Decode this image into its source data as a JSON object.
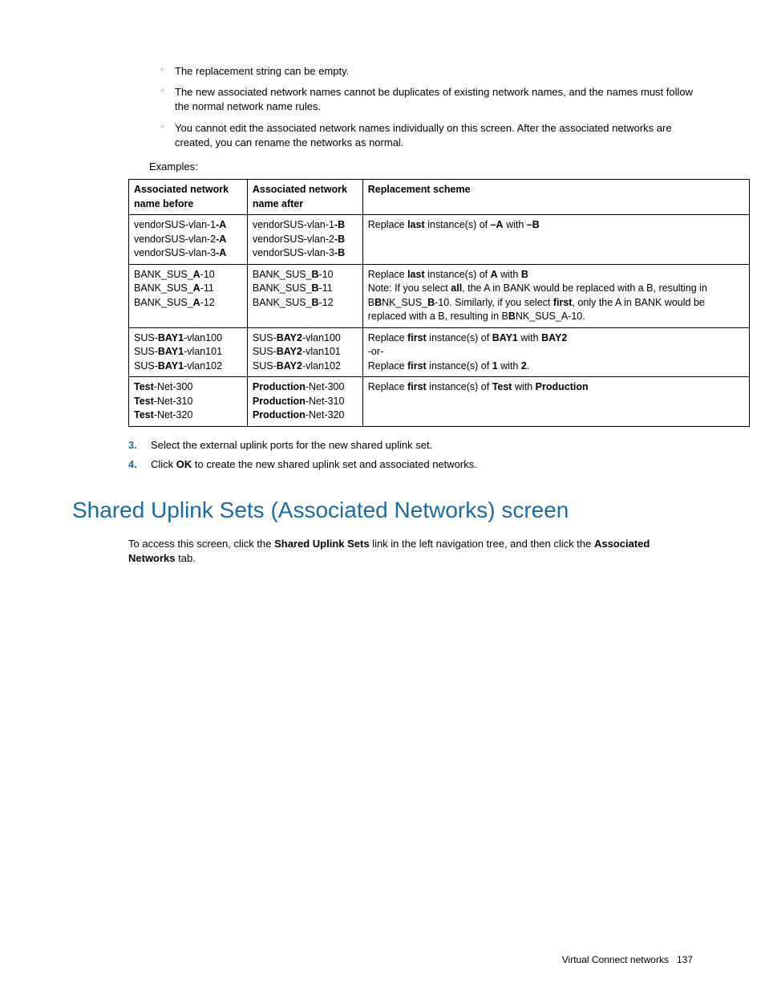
{
  "bullets": [
    "The replacement string can be empty.",
    "The new associated network names cannot be duplicates of existing network names, and the names must follow the normal network name rules.",
    "You cannot edit the associated network names individually on this screen. After the associated networks are created, you can rename the networks as normal."
  ],
  "examples_label": "Examples:",
  "table": {
    "headers": [
      "Associated network name before",
      "Associated network name after",
      "Replacement scheme"
    ],
    "rows_html": [
      {
        "before": "vendorSUS-vlan-1<b>-A</b><br>vendorSUS-vlan-2<b>-A</b><br>vendorSUS-vlan-3<b>-A</b>",
        "after": "vendorSUS-vlan-1<b>-B</b><br>vendorSUS-vlan-2<b>-B</b><br>vendorSUS-vlan-3<b>-B</b>",
        "scheme": "Replace <b>last</b> instance(s) of <b>–A</b> with <b>–B</b>"
      },
      {
        "before": "BANK_SUS_<b>A</b>-10<br>BANK_SUS_<b>A</b>-11<br>BANK_SUS_<b>A</b>-12",
        "after": "BANK_SUS_<b>B</b>-10<br>BANK_SUS_<b>B</b>-11<br>BANK_SUS_<b>B</b>-12",
        "scheme": "Replace <b>last</b> instance(s) of <b>A</b> with <b>B</b><br>Note: If you select <b>all</b>, the A in BANK would be replaced with a B, resulting in B<b>B</b>NK_SUS_<b>B</b>-10. Similarly, if you select <b>first</b>, only the A in BANK would be replaced with a B, resulting in B<b>B</b>NK_SUS_A-10."
      },
      {
        "before": "SUS-<b>BAY1</b>-vlan100<br>SUS-<b>BAY1</b>-vlan101<br>SUS-<b>BAY1</b>-vlan102",
        "after": "SUS-<b>BAY2</b>-vlan100<br>SUS-<b>BAY2</b>-vlan101<br>SUS-<b>BAY2</b>-vlan102",
        "scheme": "Replace <b>first</b> instance(s) of <b>BAY1</b> with <b>BAY2</b><br>-or-<br>Replace <b>first</b> instance(s) of <b>1</b> with <b>2</b>."
      },
      {
        "before": "<b>Test</b>-Net-300<br><b>Test</b>-Net-310<br><b>Test</b>-Net-320",
        "after": "<b>Production</b>-Net-300<br><b>Production</b>-Net-310<br><b>Production</b>-Net-320",
        "scheme": "Replace <b>first</b> instance(s) of <b>Test</b> with <b>Production</b>"
      }
    ]
  },
  "steps": [
    {
      "num": "3.",
      "text_html": "Select the external uplink ports for the new shared uplink set."
    },
    {
      "num": "4.",
      "text_html": "Click <b>OK</b> to create the new shared uplink set and associated networks."
    }
  ],
  "heading": "Shared Uplink Sets (Associated Networks) screen",
  "body_html": "To access this screen, click the <b>Shared Uplink Sets</b> link in the left navigation tree, and then click the <b>Associated Networks</b> tab.",
  "footer": {
    "section": "Virtual Connect networks",
    "page": "137"
  }
}
